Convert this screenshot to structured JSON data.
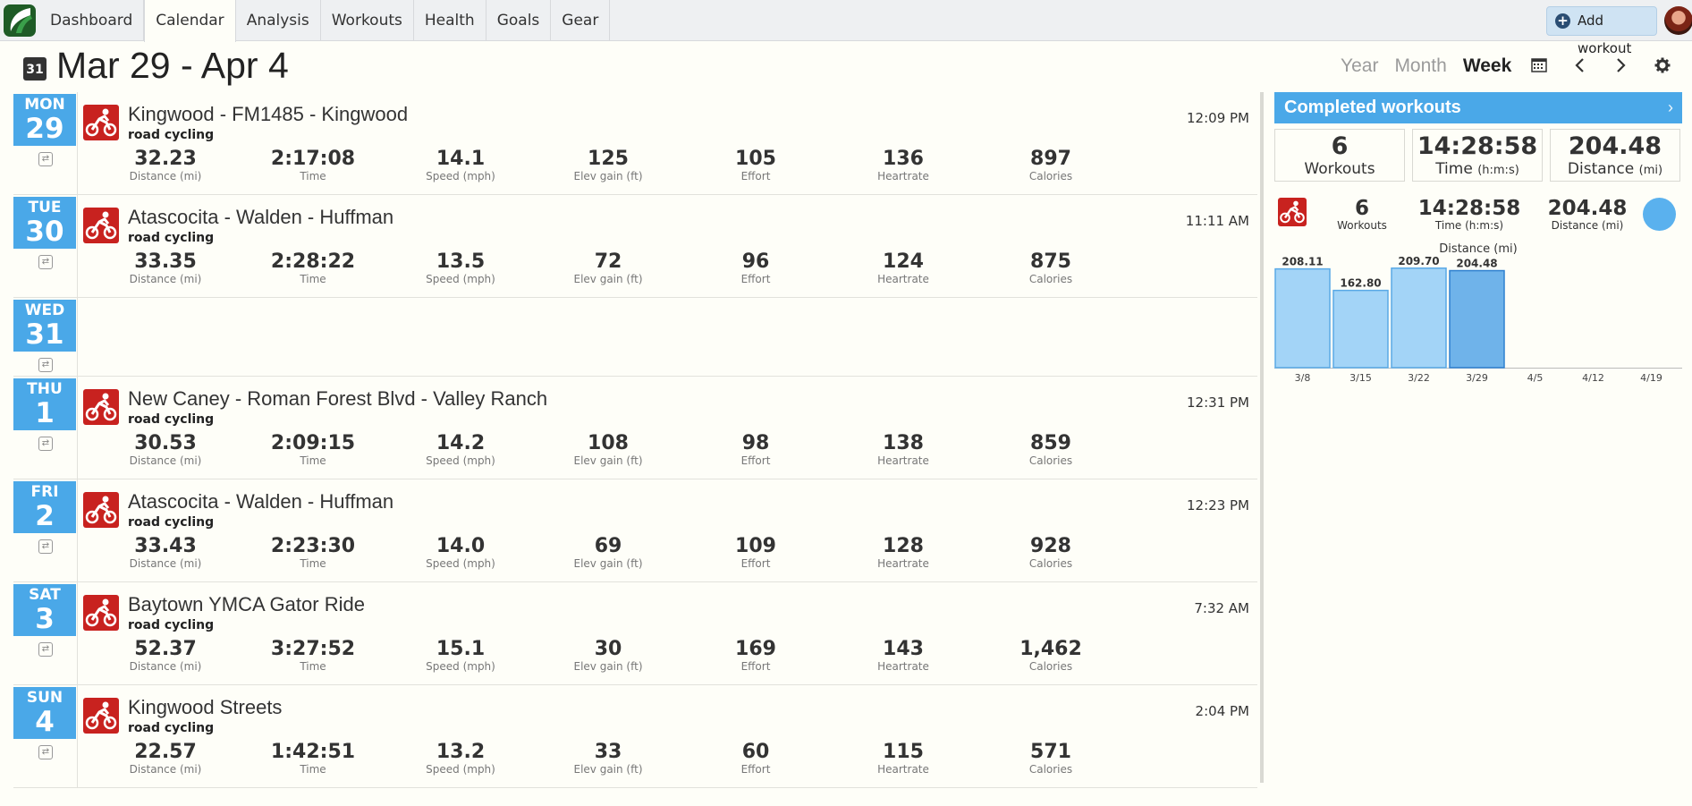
{
  "nav": {
    "tabs": [
      "Dashboard",
      "Calendar",
      "Analysis",
      "Workouts",
      "Health",
      "Goals",
      "Gear"
    ],
    "active": "Calendar",
    "add_workout": "Add workout"
  },
  "header": {
    "calendar_icon_text": "31",
    "title": "Mar 29 - Apr 4",
    "views": [
      "Year",
      "Month",
      "Week"
    ],
    "active_view": "Week"
  },
  "days": [
    {
      "dow": "MON",
      "num": "29",
      "workout": {
        "title": "Kingwood - FM1485 - Kingwood",
        "type": "road cycling",
        "time": "12:09 PM",
        "metrics": [
          [
            "32.23",
            "Distance (mi)"
          ],
          [
            "2:17:08",
            "Time"
          ],
          [
            "14.1",
            "Speed (mph)"
          ],
          [
            "125",
            "Elev gain (ft)"
          ],
          [
            "105",
            "Effort"
          ],
          [
            "136",
            "Heartrate"
          ],
          [
            "897",
            "Calories"
          ]
        ]
      }
    },
    {
      "dow": "TUE",
      "num": "30",
      "workout": {
        "title": "Atascocita - Walden - Huffman",
        "type": "road cycling",
        "time": "11:11 AM",
        "metrics": [
          [
            "33.35",
            "Distance (mi)"
          ],
          [
            "2:28:22",
            "Time"
          ],
          [
            "13.5",
            "Speed (mph)"
          ],
          [
            "72",
            "Elev gain (ft)"
          ],
          [
            "96",
            "Effort"
          ],
          [
            "124",
            "Heartrate"
          ],
          [
            "875",
            "Calories"
          ]
        ]
      }
    },
    {
      "dow": "WED",
      "num": "31",
      "workout": null
    },
    {
      "dow": "THU",
      "num": "1",
      "workout": {
        "title": "New Caney - Roman Forest Blvd - Valley Ranch",
        "type": "road cycling",
        "time": "12:31 PM",
        "metrics": [
          [
            "30.53",
            "Distance (mi)"
          ],
          [
            "2:09:15",
            "Time"
          ],
          [
            "14.2",
            "Speed (mph)"
          ],
          [
            "108",
            "Elev gain (ft)"
          ],
          [
            "98",
            "Effort"
          ],
          [
            "138",
            "Heartrate"
          ],
          [
            "859",
            "Calories"
          ]
        ]
      }
    },
    {
      "dow": "FRI",
      "num": "2",
      "workout": {
        "title": "Atascocita - Walden - Huffman",
        "type": "road cycling",
        "time": "12:23 PM",
        "metrics": [
          [
            "33.43",
            "Distance (mi)"
          ],
          [
            "2:23:30",
            "Time"
          ],
          [
            "14.0",
            "Speed (mph)"
          ],
          [
            "69",
            "Elev gain (ft)"
          ],
          [
            "109",
            "Effort"
          ],
          [
            "128",
            "Heartrate"
          ],
          [
            "928",
            "Calories"
          ]
        ]
      }
    },
    {
      "dow": "SAT",
      "num": "3",
      "workout": {
        "title": "Baytown YMCA Gator Ride",
        "type": "road cycling",
        "time": "7:32 AM",
        "metrics": [
          [
            "52.37",
            "Distance (mi)"
          ],
          [
            "3:27:52",
            "Time"
          ],
          [
            "15.1",
            "Speed (mph)"
          ],
          [
            "30",
            "Elev gain (ft)"
          ],
          [
            "169",
            "Effort"
          ],
          [
            "143",
            "Heartrate"
          ],
          [
            "1,462",
            "Calories"
          ]
        ]
      }
    },
    {
      "dow": "SUN",
      "num": "4",
      "workout": {
        "title": "Kingwood Streets",
        "type": "road cycling",
        "time": "2:04 PM",
        "metrics": [
          [
            "22.57",
            "Distance (mi)"
          ],
          [
            "1:42:51",
            "Time"
          ],
          [
            "13.2",
            "Speed (mph)"
          ],
          [
            "33",
            "Elev gain (ft)"
          ],
          [
            "60",
            "Effort"
          ],
          [
            "115",
            "Heartrate"
          ],
          [
            "571",
            "Calories"
          ]
        ]
      }
    }
  ],
  "panel": {
    "title": "Completed workouts",
    "summary": [
      {
        "value": "6",
        "label": "Workouts",
        "unit": ""
      },
      {
        "value": "14:28:58",
        "label": "Time",
        "unit": "(h:m:s)"
      },
      {
        "value": "204.48",
        "label": "Distance",
        "unit": "(mi)"
      }
    ],
    "by_type": [
      {
        "value": "6",
        "label": "Workouts"
      },
      {
        "value": "14:28:58",
        "label": "Time (h:m:s)"
      },
      {
        "value": "204.48",
        "label": "Distance (mi)"
      }
    ]
  },
  "chart_data": {
    "type": "bar",
    "title": "Distance (mi)",
    "categories": [
      "3/8",
      "3/15",
      "3/22",
      "3/29",
      "4/5",
      "4/12",
      "4/19"
    ],
    "values": [
      208.11,
      162.8,
      209.7,
      204.48,
      null,
      null,
      null
    ],
    "value_labels": [
      "208.11",
      "162.80",
      "209.70",
      "204.48",
      "",
      "",
      ""
    ],
    "highlight_index": 3,
    "ylim": [
      0,
      230
    ],
    "colors": {
      "bar": "#a3d4f7",
      "bar_border": "#5aa9e6",
      "highlight": "#6fb3ea",
      "highlight_border": "#2f80cf"
    }
  }
}
